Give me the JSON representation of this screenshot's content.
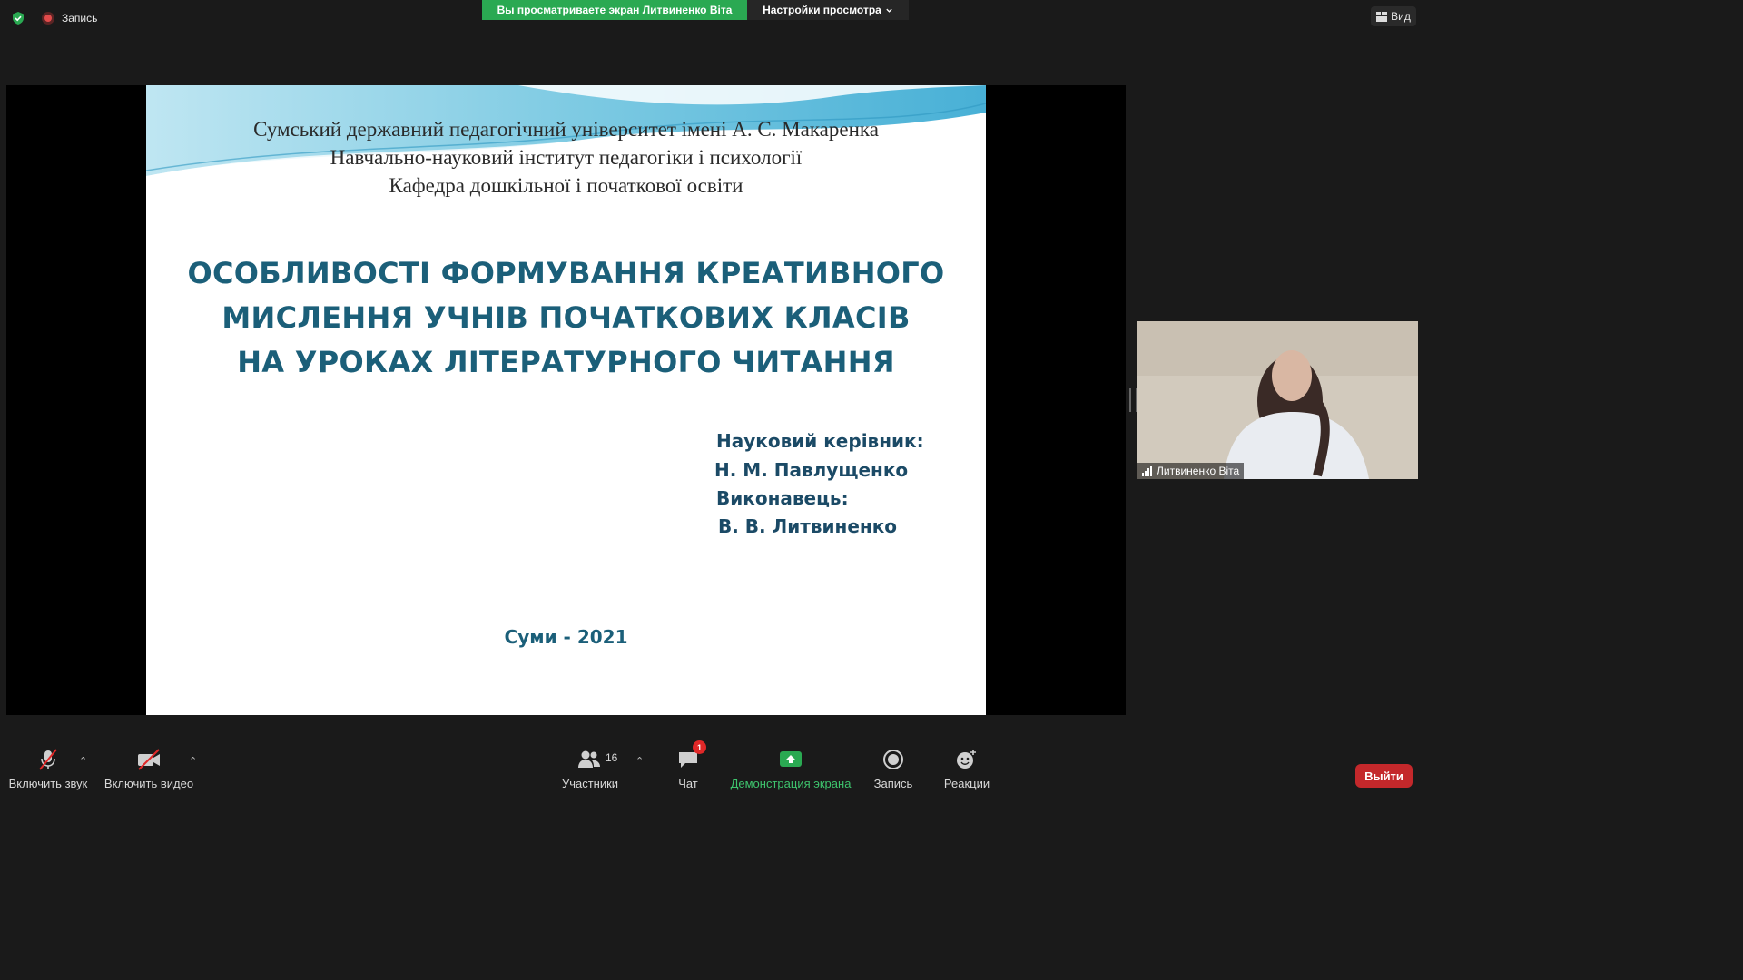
{
  "topbar": {
    "recording_label": "Запись",
    "share_banner": "Вы просматриваете экран Литвиненко Віта",
    "view_settings": "Настройки просмотра",
    "view_button": "Вид"
  },
  "slide": {
    "header_lines": [
      "Сумський державний педагогічний університет імені А. С. Макаренка",
      "Навчально-науковий інститут педагогіки і психології",
      "Кафедра дошкільної і початкової освіти"
    ],
    "title_lines": [
      "ОСОБЛИВОСТІ ФОРМУВАННЯ КРЕАТИВНОГО",
      "МИСЛЕННЯ УЧНІВ ПОЧАТКОВИХ КЛАСІВ",
      "НА УРОКАХ ЛІТЕРАТУРНОГО ЧИТАННЯ"
    ],
    "supervisor_label": "Науковий керівник:",
    "supervisor_name": "Н. М. Павлущенко",
    "author_label": "Виконавець:",
    "author_name": "В. В. Литвиненко",
    "city_year": "Суми - 2021"
  },
  "participant": {
    "name": "Литвиненко Віта"
  },
  "toolbar": {
    "audio_label": "Включить звук",
    "video_label": "Включить видео",
    "participants_label": "Участники",
    "participants_count": "16",
    "chat_label": "Чат",
    "chat_badge": "1",
    "share_label": "Демонстрация экрана",
    "record_label": "Запись",
    "reactions_label": "Реакции",
    "leave_label": "Выйти"
  },
  "colors": {
    "share_green": "#2aa952",
    "leave_red": "#c4282b",
    "slide_title": "#1b5f79",
    "background": "#1a1a1a"
  },
  "icons": [
    "shield-icon",
    "record-dot-icon",
    "caret-down-icon",
    "grid-view-icon",
    "signal-bars-icon",
    "mic-muted-icon",
    "camera-off-icon",
    "participants-icon",
    "chat-icon",
    "share-screen-icon",
    "record-icon",
    "reactions-icon"
  ]
}
